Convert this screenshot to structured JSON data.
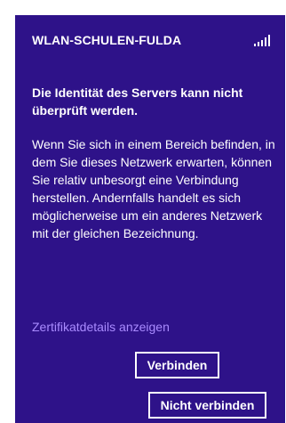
{
  "network": {
    "ssid": "WLAN-SCHULEN-FULDA",
    "signal_icon": "signal-strength-icon",
    "signal_bars_active": 5
  },
  "dialog": {
    "warning": "Die Identität des Servers kann nicht überprüft werden.",
    "body": "Wenn Sie sich in einem Bereich befinden, in dem Sie dieses Netzwerk erwarten, können Sie relativ unbesorgt eine Verbindung herstellen. Andernfalls handelt es sich möglicherweise um ein anderes Netzwerk mit der gleichen Bezeichnung.",
    "details_link": "Zertifikatdetails anzeigen"
  },
  "buttons": {
    "connect": "Verbinden",
    "dont_connect": "Nicht verbinden"
  },
  "colors": {
    "panel_bg": "#2e1289",
    "text": "#ffffff",
    "link": "#a98bff"
  }
}
